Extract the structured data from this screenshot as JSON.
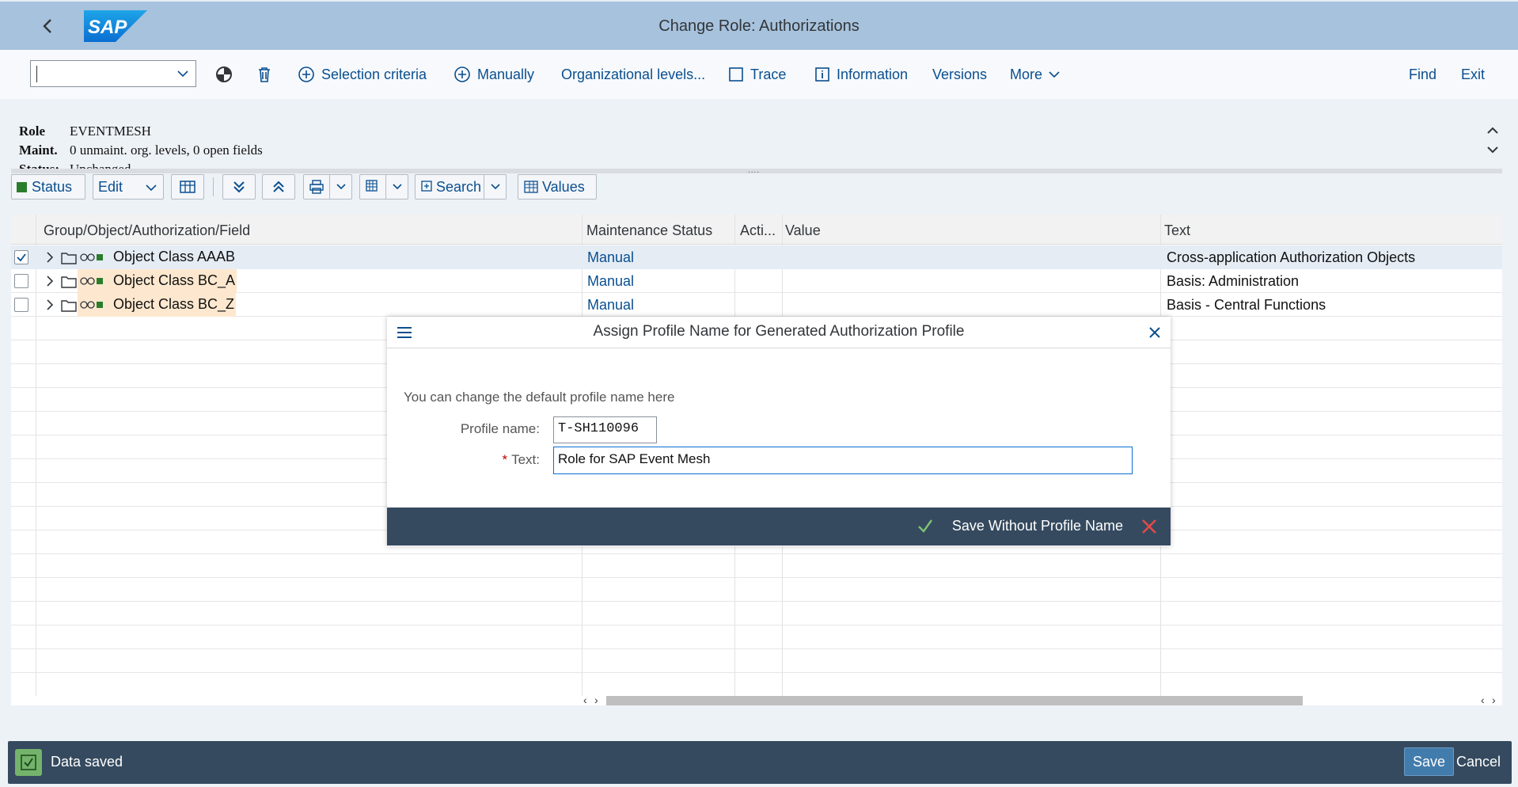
{
  "shell": {
    "title": "Change Role: Authorizations",
    "logo_text": "SAP"
  },
  "toolbar": {
    "command_value": "",
    "selection_criteria": "Selection criteria",
    "manually": "Manually",
    "org_levels": "Organizational levels...",
    "trace": "Trace",
    "information": "Information",
    "versions": "Versions",
    "more": "More",
    "find": "Find",
    "exit": "Exit"
  },
  "header": {
    "role_label": "Role",
    "role_value": "EVENTMESH",
    "maint_label": "Maint.",
    "maint_value": "0 unmaint. org. levels, 0 open fields",
    "status_label": "Status:",
    "status_value": "Unchanged"
  },
  "alv_toolbar": {
    "status": "Status",
    "edit": "Edit",
    "search": "Search",
    "values": "Values"
  },
  "grid": {
    "columns": [
      "Group/Object/Authorization/Field",
      "Maintenance Status",
      "Acti...",
      "Value",
      "Text"
    ],
    "rows": [
      {
        "object": "Object Class AAAB",
        "status": "Manual",
        "text": "Cross-application Authorization Objects",
        "checked": true
      },
      {
        "object": "Object Class BC_A",
        "status": "Manual",
        "text": "Basis: Administration",
        "checked": false
      },
      {
        "object": "Object Class BC_Z",
        "status": "Manual",
        "text": "Basis - Central Functions",
        "checked": false
      }
    ]
  },
  "dialog": {
    "title": "Assign Profile Name for Generated Authorization Profile",
    "description": "You can change the default profile name here",
    "profile_label": "Profile name:",
    "profile_value": "T-SH110096",
    "text_label": "Text:",
    "text_value": "Role for SAP Event Mesh",
    "save_without": "Save Without Profile Name"
  },
  "statusbar": {
    "message": "Data saved",
    "save": "Save",
    "cancel": "Cancel"
  },
  "colors": {
    "shell": "#a7c2dc",
    "link": "#0a4f8f",
    "footer": "#354a5f",
    "success": "#74b36b",
    "highlight": "#fde8cf"
  }
}
